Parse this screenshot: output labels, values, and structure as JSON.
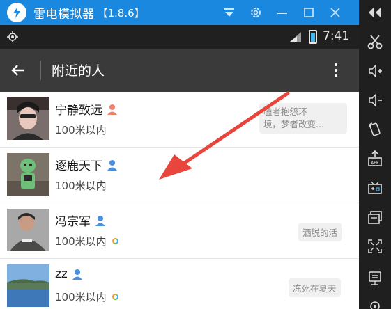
{
  "window": {
    "title": "雷电模拟器",
    "version": "【1.8.6】"
  },
  "statusbar": {
    "time": "7:41"
  },
  "appbar": {
    "title": "附近的人"
  },
  "people": [
    {
      "name": "宁静致远",
      "gender": "female",
      "distance": "100米以内",
      "signature": "嗑者抱怨环境，梦者改变...",
      "online": false
    },
    {
      "name": "逐鹿天下",
      "gender": "male",
      "distance": "100米以内",
      "signature": "",
      "online": false
    },
    {
      "name": "冯宗军",
      "gender": "male",
      "distance": "100米以内",
      "signature": "洒脱的活",
      "online": true
    },
    {
      "name": "zz",
      "gender": "male",
      "distance": "100米以内",
      "signature": "冻死在夏天",
      "online": true
    }
  ],
  "sig_lines": {
    "first_line1": "嗑者抱怨环",
    "first_line2": "境，梦者改变..."
  },
  "colors": {
    "titlebar": "#1b88e0",
    "female": "#f0826a",
    "male": "#4a90e2",
    "arrow": "#e8453c"
  }
}
